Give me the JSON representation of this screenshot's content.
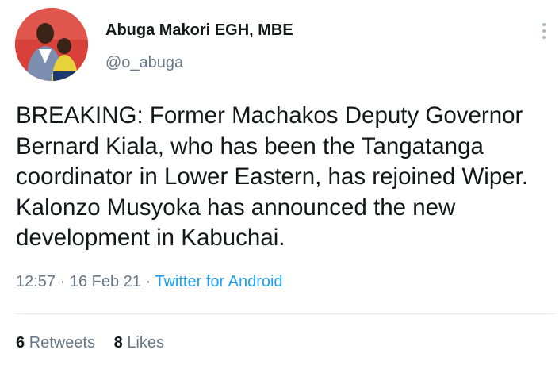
{
  "author": {
    "display_name": "Abuga Makori EGH, MBE",
    "handle": "@o_abuga",
    "avatar": "profile-photo"
  },
  "tweet": {
    "text": "BREAKING: Former Machakos Deputy Governor Bernard Kiala, who has been the Tangatanga coordinator in Lower Eastern, has rejoined Wiper. Kalonzo Musyoka has announced the new development in Kabuchai.",
    "time": "12:57",
    "date": "16 Feb 21",
    "separator": "·",
    "source": "Twitter for Android"
  },
  "stats": {
    "retweets_count": "6",
    "retweets_label": "Retweets",
    "likes_count": "8",
    "likes_label": "Likes"
  },
  "colors": {
    "link": "#1da1f2",
    "secondary_text": "#657786",
    "primary_text": "#14171a"
  },
  "icons": {
    "more": "more-vertical-icon"
  }
}
